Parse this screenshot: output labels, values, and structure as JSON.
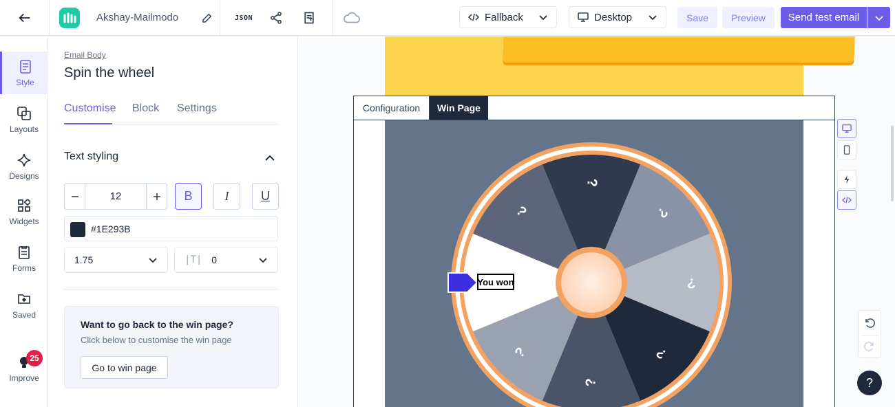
{
  "header": {
    "document_name": "Akshay-Mailmodo",
    "json_label": "JSON",
    "fallback_dropdown": "Fallback",
    "device_dropdown": "Desktop",
    "save_label": "Save",
    "preview_label": "Preview",
    "send_test_label": "Send test email"
  },
  "rail": {
    "items": [
      {
        "label": "Style"
      },
      {
        "label": "Layouts"
      },
      {
        "label": "Designs"
      },
      {
        "label": "Widgets"
      },
      {
        "label": "Forms"
      },
      {
        "label": "Saved"
      },
      {
        "label": "Improve",
        "badge": "25"
      }
    ]
  },
  "panel": {
    "breadcrumb": "Email Body",
    "title": "Spin the wheel",
    "tabs": [
      {
        "label": "Customise"
      },
      {
        "label": "Block"
      },
      {
        "label": "Settings"
      }
    ],
    "section_title": "Text styling",
    "font_size": "12",
    "bold_label": "B",
    "italic_label": "I",
    "underline_label": "U",
    "color_hex": "#1E293B",
    "line_height": "1.75",
    "letter_spacing_icon": "|T|",
    "letter_spacing": "0",
    "info_card": {
      "title": "Want to go back to the win page?",
      "text": "Click below to customise the win page",
      "button": "Go to win page"
    }
  },
  "canvas": {
    "tabs": [
      {
        "label": "Configuration"
      },
      {
        "label": "Win Page"
      }
    ],
    "wheel": {
      "segment_label": "?",
      "winning_label": "You won"
    },
    "help_label": "?"
  },
  "colors": {
    "accent": "#6c5ce7",
    "wheel_background": "#64748b",
    "wheel_rim": "#f4a261",
    "yellow_block": "#fcd34d"
  }
}
